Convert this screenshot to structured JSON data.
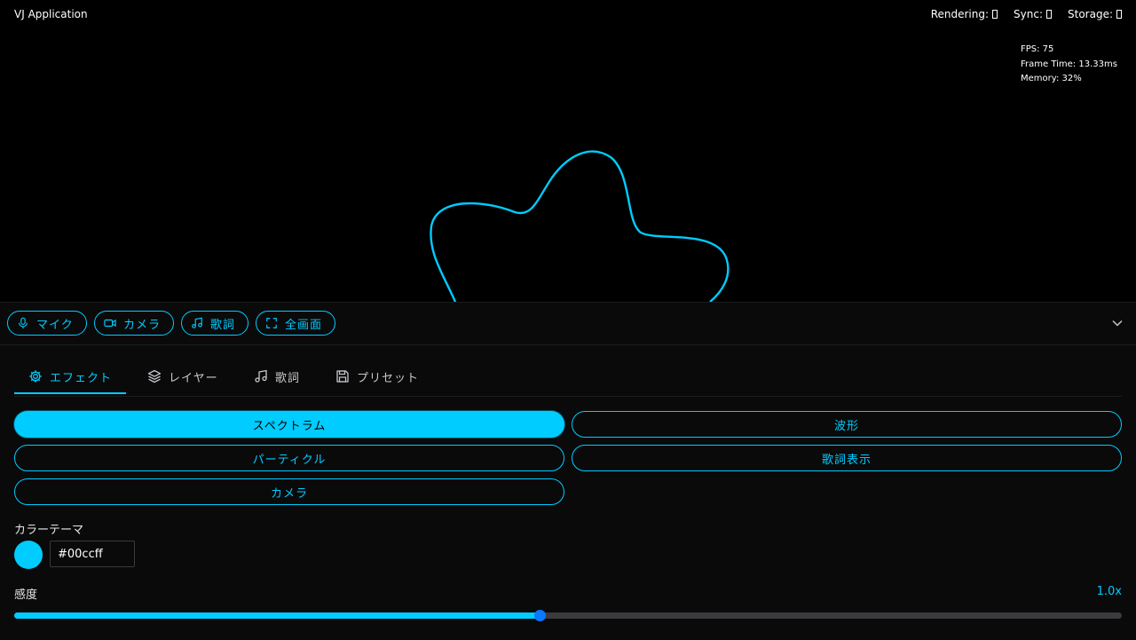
{
  "app": {
    "title": "VJ Application"
  },
  "status": {
    "rendering_label": "Rendering:",
    "sync_label": "Sync:",
    "storage_label": "Storage:"
  },
  "perf": {
    "fps": "FPS: 75",
    "frame_time": "Frame Time: 13.33ms",
    "memory": "Memory: 32%"
  },
  "quick_toggles": [
    {
      "label": "マイク",
      "icon": "microphone-icon"
    },
    {
      "label": "カメラ",
      "icon": "video-camera-icon"
    },
    {
      "label": "歌詞",
      "icon": "music-note-icon"
    },
    {
      "label": "全画面",
      "icon": "fullscreen-icon"
    }
  ],
  "tabs": [
    {
      "label": "エフェクト",
      "icon": "gear-icon",
      "active": true
    },
    {
      "label": "レイヤー",
      "icon": "layers-icon",
      "active": false
    },
    {
      "label": "歌詞",
      "icon": "music-note-icon",
      "active": false
    },
    {
      "label": "プリセット",
      "icon": "save-icon",
      "active": false
    }
  ],
  "effects": [
    {
      "label": "スペクトラム",
      "active": true
    },
    {
      "label": "波形",
      "active": false
    },
    {
      "label": "パーティクル",
      "active": false
    },
    {
      "label": "歌詞表示",
      "active": false
    },
    {
      "label": "カメラ",
      "active": false
    }
  ],
  "color_theme": {
    "label": "カラーテーマ",
    "value": "#00ccff"
  },
  "sensitivity": {
    "label": "感度",
    "value_text": "1.0x",
    "fraction": 0.474
  },
  "colors": {
    "accent": "#00ccff",
    "background": "#000000",
    "panel": "#0a0a0b",
    "slider_thumb": "#0a78ff"
  }
}
